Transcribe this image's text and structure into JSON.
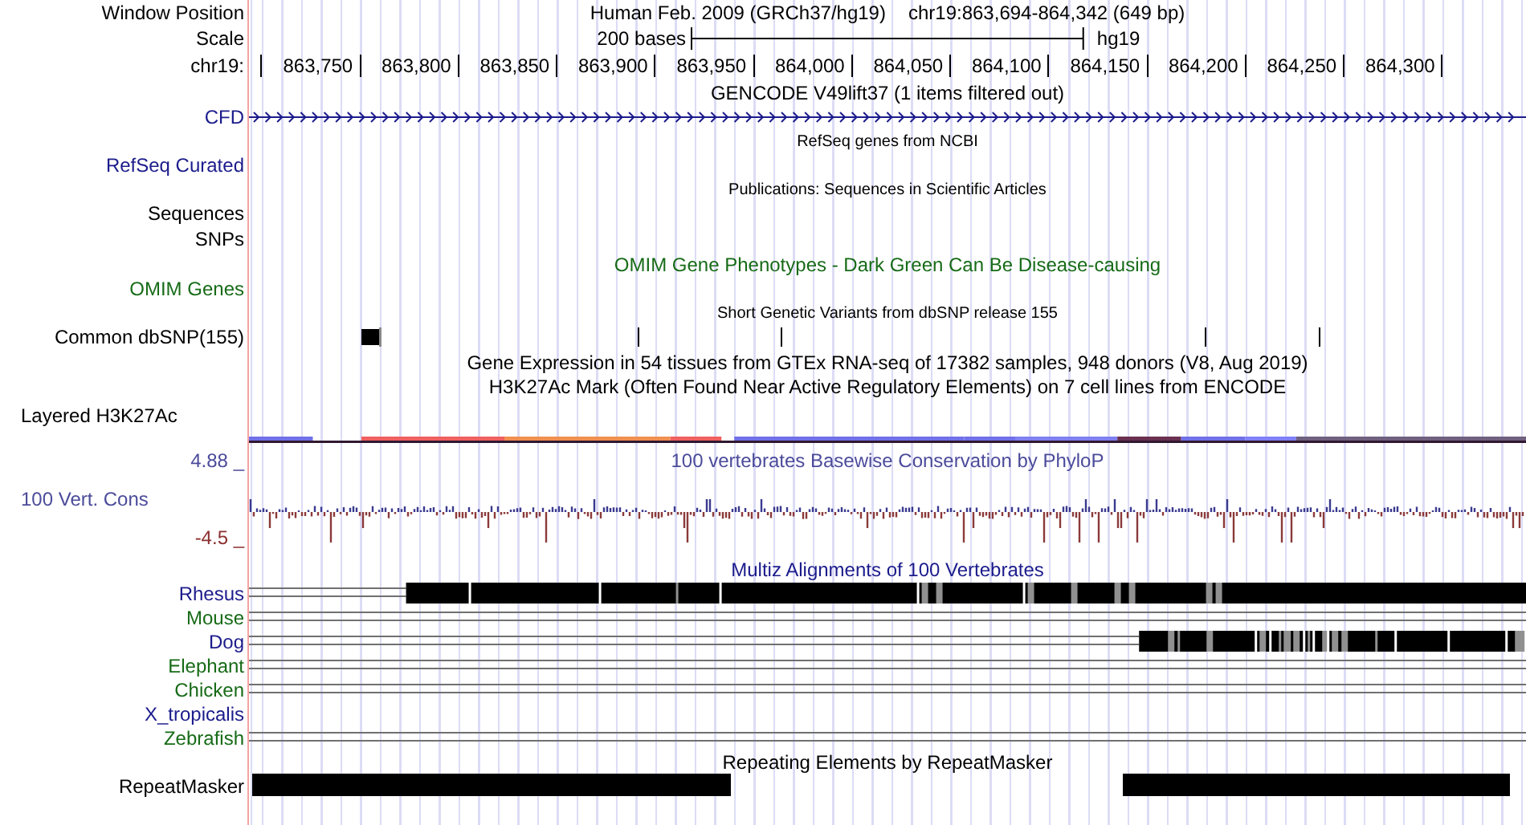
{
  "header": {
    "label": "Window Position",
    "title": "Human Feb. 2009 (GRCh37/hg19)",
    "position": "chr19:863,694-864,342 (649 bp)"
  },
  "scale": {
    "label": "Scale",
    "bar_text": "200 bases",
    "assembly": "hg19"
  },
  "ruler": {
    "label": "chr19:",
    "ticks": [
      "863,750",
      "863,800",
      "863,850",
      "863,900",
      "863,950",
      "864,000",
      "864,050",
      "864,100",
      "864,150",
      "864,200",
      "864,250",
      "864,300"
    ]
  },
  "rows": [
    {
      "kind": "title",
      "title": "GENCODE V49lift37 (1 items filtered out)",
      "color": "#000000"
    },
    {
      "kind": "gene",
      "label": "CFD",
      "color": "#1b1b8c"
    },
    {
      "kind": "small-title",
      "title": "RefSeq genes from NCBI"
    },
    {
      "kind": "empty",
      "label": "RefSeq Curated",
      "color": "#1b1b8c"
    },
    {
      "kind": "small-title",
      "title": "Publications: Sequences in Scientific Articles"
    },
    {
      "kind": "empty",
      "label": "Sequences",
      "color": "#000000"
    },
    {
      "kind": "empty",
      "label": "SNPs",
      "color": "#000000"
    },
    {
      "kind": "title",
      "title": "OMIM Gene Phenotypes - Dark Green Can Be Disease-causing",
      "color": "#176b17"
    },
    {
      "kind": "empty",
      "label": "OMIM Genes",
      "color": "#176b17"
    },
    {
      "kind": "small-title",
      "title": "Short Genetic Variants from dbSNP release 155"
    },
    {
      "kind": "snp",
      "label": "Common dbSNP(155)",
      "color": "#000000"
    },
    {
      "kind": "title",
      "title": "Gene Expression in 54 tissues from GTEx RNA-seq of 17382 samples, 948 donors (V8, Aug 2019)",
      "color": "#000000"
    },
    {
      "kind": "title",
      "title": "H3K27Ac Mark (Often Found Near Active Regulatory Elements) on 7 cell lines from ENCODE",
      "color": "#000000"
    },
    {
      "kind": "layered",
      "label": "Layered H3K27Ac",
      "color": "#000000"
    },
    {
      "kind": "wiggle",
      "title": "100 vertebrates Basewise Conservation by PhyloP",
      "label": "100 Vert. Cons",
      "max_label": "4.88 _",
      "min_label": "-4.5 _",
      "color": "#4b4b9b"
    },
    {
      "kind": "title",
      "title": "Multiz Alignments of 100 Vertebrates",
      "color": "#1b1b8c"
    },
    {
      "kind": "align",
      "species": [
        {
          "name": "Rhesus",
          "color": "#1b1b8c",
          "kind": "blocks"
        },
        {
          "name": "Mouse",
          "color": "#176b17",
          "kind": "lines"
        },
        {
          "name": "Dog",
          "color": "#1b1b8c",
          "kind": "blocks"
        },
        {
          "name": "Elephant",
          "color": "#176b17",
          "kind": "lines"
        },
        {
          "name": "Chicken",
          "color": "#176b17",
          "kind": "lines"
        },
        {
          "name": "X_tropicalis",
          "color": "#1b1b8c",
          "kind": "none"
        },
        {
          "name": "Zebrafish",
          "color": "#176b17",
          "kind": "lines"
        }
      ]
    },
    {
      "kind": "title",
      "title": "Repeating Elements by RepeatMasker",
      "color": "#000000"
    },
    {
      "kind": "repeat",
      "label": "RepeatMasker",
      "color": "#000000"
    }
  ]
}
